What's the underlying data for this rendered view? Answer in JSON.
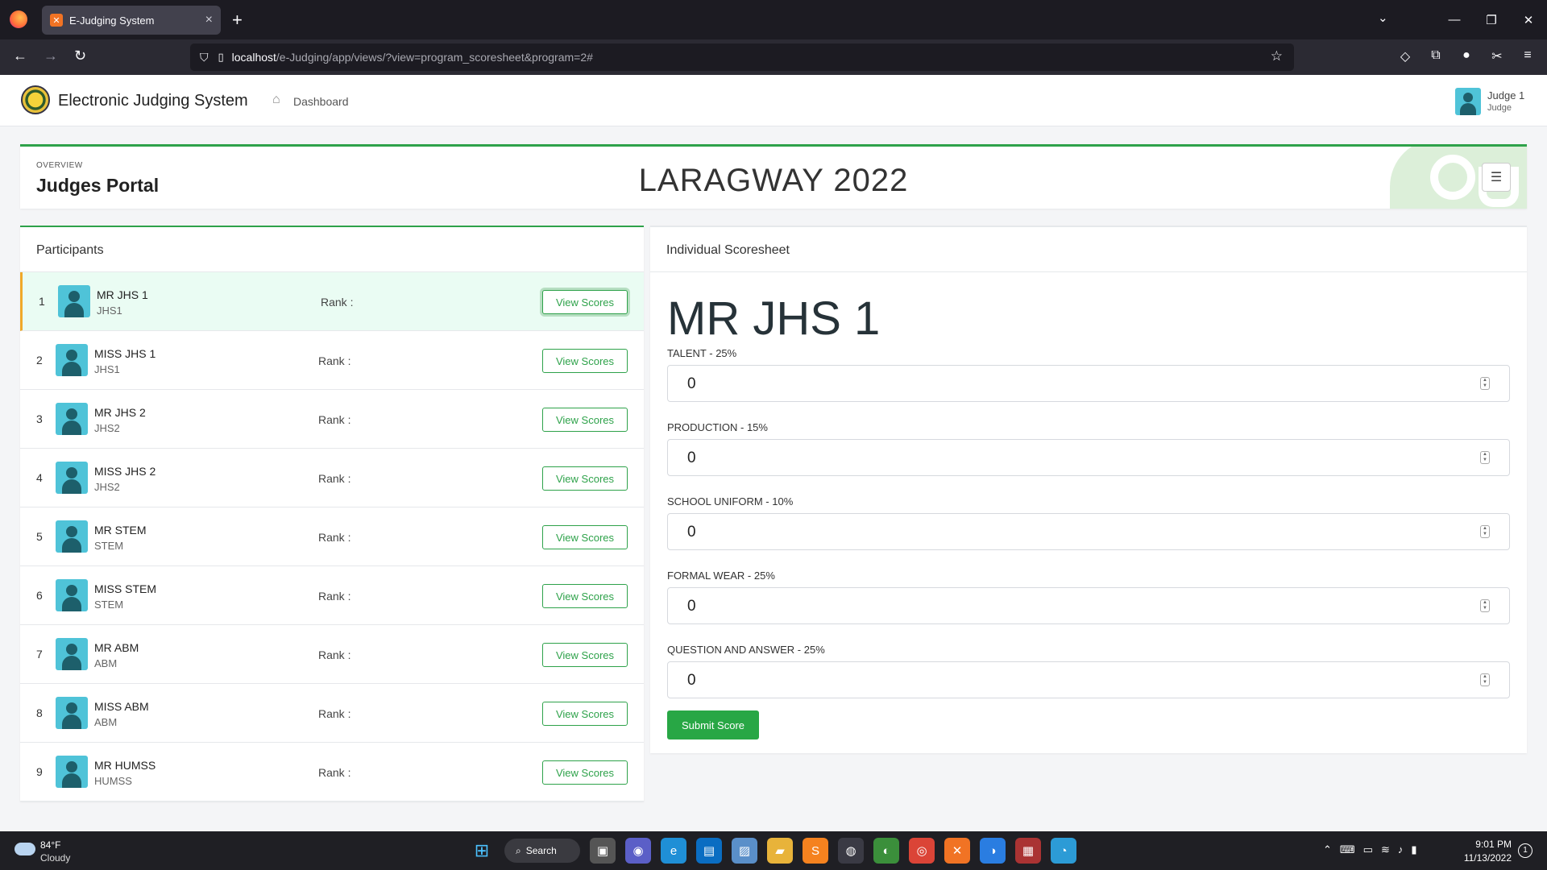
{
  "browser": {
    "tab_title": "E-Judging System",
    "tab_favicon": "xampp-icon",
    "url_host": "localhost",
    "url_path": "/e-Judging/app/views/?view=program_scoresheet&program=2#"
  },
  "header": {
    "app_title": "Electronic Judging System",
    "dashboard_link": "Dashboard",
    "user_name": "Judge 1",
    "user_role": "Judge"
  },
  "overview": {
    "label": "OVERVIEW",
    "title": "Judges Portal",
    "event_name": "LARAGWAY 2022"
  },
  "participants": {
    "heading": "Participants",
    "rank_label": "Rank :",
    "button_label": "View Scores",
    "items": [
      {
        "num": "1",
        "name": "MR JHS 1",
        "code": "JHS1"
      },
      {
        "num": "2",
        "name": "MISS JHS 1",
        "code": "JHS1"
      },
      {
        "num": "3",
        "name": "MR JHS 2",
        "code": "JHS2"
      },
      {
        "num": "4",
        "name": "MISS JHS 2",
        "code": "JHS2"
      },
      {
        "num": "5",
        "name": "MR STEM",
        "code": "STEM"
      },
      {
        "num": "6",
        "name": "MISS STEM",
        "code": "STEM"
      },
      {
        "num": "7",
        "name": "MR ABM",
        "code": "ABM"
      },
      {
        "num": "8",
        "name": "MISS ABM",
        "code": "ABM"
      },
      {
        "num": "9",
        "name": "MR HUMSS",
        "code": "HUMSS"
      }
    ]
  },
  "scoresheet": {
    "heading": "Individual Scoresheet",
    "participant_name": "MR JHS 1",
    "criteria": [
      {
        "label": "TALENT - 25%",
        "value": "0"
      },
      {
        "label": "PRODUCTION - 15%",
        "value": "0"
      },
      {
        "label": "SCHOOL UNIFORM - 10%",
        "value": "0"
      },
      {
        "label": "FORMAL WEAR - 25%",
        "value": "0"
      },
      {
        "label": "QUESTION AND ANSWER - 25%",
        "value": "0"
      }
    ],
    "submit_label": "Submit Score"
  },
  "taskbar": {
    "temperature": "84°F",
    "weather": "Cloudy",
    "search_label": "Search",
    "time": "9:01 PM",
    "date": "11/13/2022",
    "notification_count": "1"
  },
  "colors": {
    "accent_green": "#2ea24a",
    "active_row_bg": "#eafcf3",
    "active_row_marker": "#f0a92a",
    "avatar_bg": "#4fc3d8"
  }
}
